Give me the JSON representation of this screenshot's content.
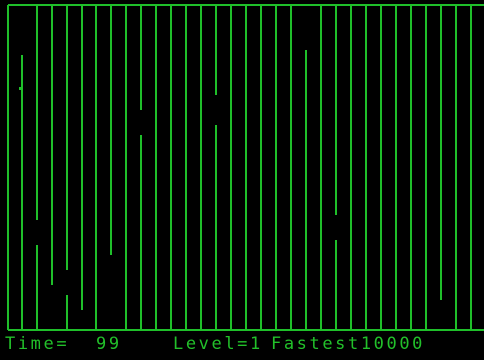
{
  "game": {
    "colors": {
      "background": "#000000",
      "wall": "#1fbf2a",
      "text": "#22c02a"
    },
    "player": {
      "icon": "player-dot-icon"
    }
  },
  "status": {
    "time_label": "Time=",
    "time_value": "99",
    "level_text": "Level=1",
    "fastest_text": "Fastest10000"
  }
}
